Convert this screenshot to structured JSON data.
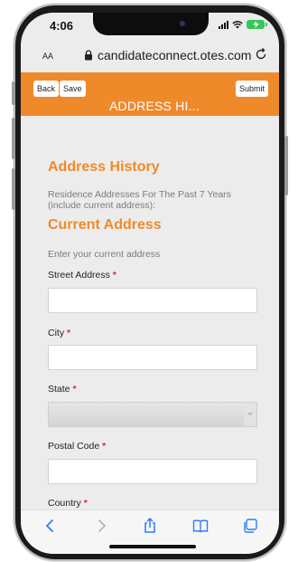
{
  "status_bar": {
    "time": "4:06",
    "battery": ""
  },
  "url_bar": {
    "text_size_label": "AA",
    "url": "candidateconnect.otes.com"
  },
  "app_header": {
    "back_label": "Back",
    "save_label": "Save",
    "submit_label": "Submit",
    "title": "ADDRESS HI..."
  },
  "form": {
    "section_title": "Address History",
    "section_description": "Residence Addresses For The Past 7 Years (include current address):",
    "subsection_title": "Current Address",
    "instructions": "Enter your current address",
    "required_marker": "*",
    "fields": {
      "street": {
        "label": "Street Address",
        "value": ""
      },
      "city": {
        "label": "City",
        "value": ""
      },
      "state": {
        "label": "State",
        "value": ""
      },
      "postal": {
        "label": "Postal Code",
        "value": ""
      },
      "country": {
        "label": "Country"
      }
    }
  },
  "colors": {
    "accent": "#ef8a2b",
    "required": "#d0302b",
    "background": "#ececec"
  },
  "toolbar": [
    "back-icon",
    "forward-icon",
    "share-icon",
    "bookmarks-icon",
    "tabs-icon"
  ]
}
